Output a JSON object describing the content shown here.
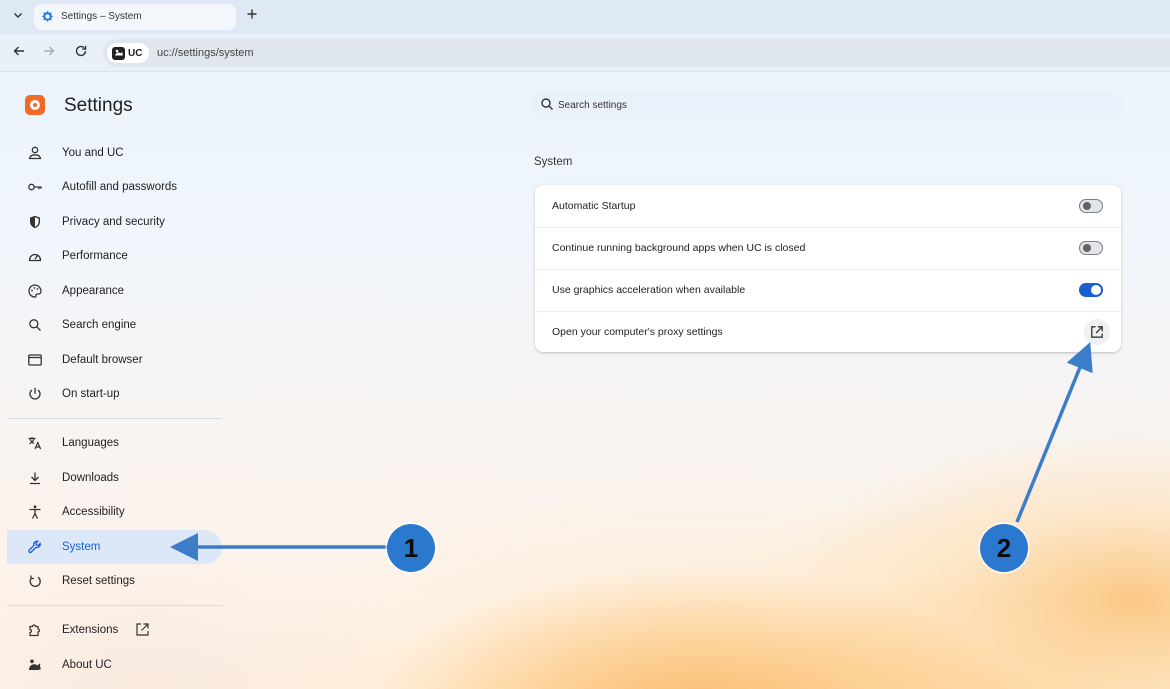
{
  "browser": {
    "tab_title": "Settings – System",
    "site_chip": "UC",
    "url": "uc://settings/system"
  },
  "header": {
    "title": "Settings",
    "search_placeholder": "Search settings"
  },
  "sidebar": {
    "items": [
      {
        "label": "You and UC",
        "icon": "person-icon"
      },
      {
        "label": "Autofill and passwords",
        "icon": "key-icon"
      },
      {
        "label": "Privacy and security",
        "icon": "shield-icon"
      },
      {
        "label": "Performance",
        "icon": "speedometer-icon"
      },
      {
        "label": "Appearance",
        "icon": "palette-icon"
      },
      {
        "label": "Search engine",
        "icon": "search-icon"
      },
      {
        "label": "Default browser",
        "icon": "browser-window-icon"
      },
      {
        "label": "On start-up",
        "icon": "power-icon"
      },
      {
        "label": "Languages",
        "icon": "translate-icon"
      },
      {
        "label": "Downloads",
        "icon": "download-icon"
      },
      {
        "label": "Accessibility",
        "icon": "accessibility-icon"
      },
      {
        "label": "System",
        "icon": "wrench-icon",
        "active": true
      },
      {
        "label": "Reset settings",
        "icon": "reset-icon"
      },
      {
        "label": "Extensions",
        "icon": "puzzle-icon"
      },
      {
        "label": "About UC",
        "icon": "uc-logo-icon"
      }
    ]
  },
  "main": {
    "section_title": "System",
    "rows": [
      {
        "label": "Automatic Startup",
        "control": "toggle",
        "state": "off"
      },
      {
        "label": "Continue running background apps when UC is closed",
        "control": "toggle",
        "state": "off"
      },
      {
        "label": "Use graphics acceleration when available",
        "control": "toggle",
        "state": "on"
      },
      {
        "label": "Open your computer's proxy settings",
        "control": "external-link-button"
      }
    ]
  },
  "annotations": [
    {
      "number": "1"
    },
    {
      "number": "2"
    }
  ],
  "colors": {
    "accent": "#1a5fd0",
    "annotation": "#2b79cf",
    "logo": "#f26a2a"
  }
}
